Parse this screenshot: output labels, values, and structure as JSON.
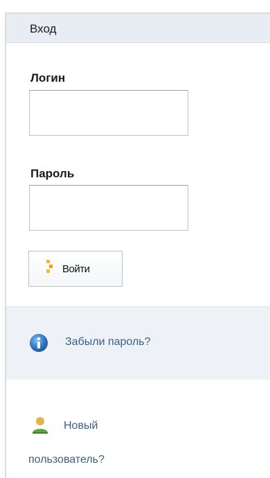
{
  "header": {
    "title": "Вход"
  },
  "login": {
    "label": "Логин",
    "value": ""
  },
  "password": {
    "label": "Пароль",
    "value": ""
  },
  "submit": {
    "label": "Войти",
    "icon": "arrow-icon"
  },
  "forgot": {
    "icon": "info-icon",
    "label": "Забыли пароль?"
  },
  "new_user": {
    "icon": "user-icon",
    "label_line1": "Новый",
    "label_line2": "пользователь?"
  },
  "colors": {
    "header_bg": "#e7edf3",
    "link": "#3a5f86",
    "info_icon": "#2f78c4",
    "user_icon_head": "#e8b24a",
    "user_icon_body": "#5aa63a",
    "arrow": "#f2a20c"
  }
}
